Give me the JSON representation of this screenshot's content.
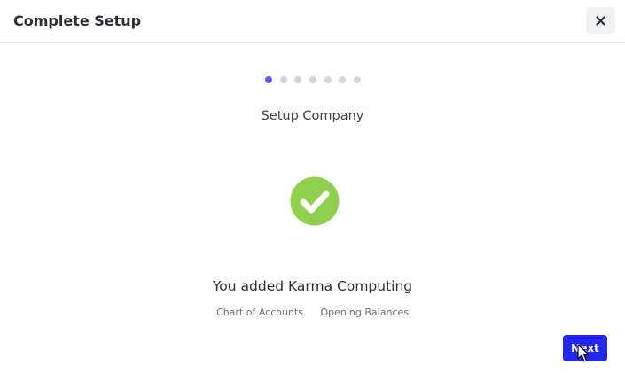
{
  "header": {
    "title": "Complete Setup",
    "close_icon": "close-icon"
  },
  "steps": {
    "total": 7,
    "current": 1,
    "title": "Setup Company"
  },
  "content": {
    "icon": "check-circle-icon",
    "icon_color": "#8fd14f",
    "message": "You added Karma Computing",
    "links": [
      "Chart of Accounts",
      "Opening Balances"
    ]
  },
  "footer": {
    "next_label": "Next",
    "next_color": "#2525f0"
  },
  "colors": {
    "active_step": "#5b5bf0",
    "inactive_step": "#d1d5db"
  }
}
